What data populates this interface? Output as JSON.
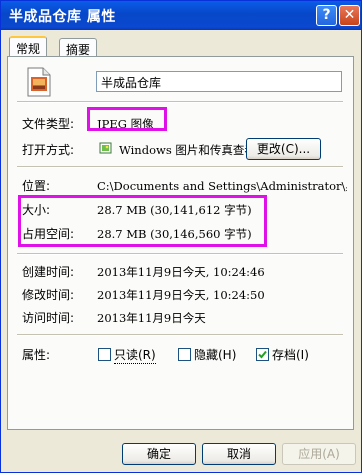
{
  "window": {
    "title": "半成品仓库 属性",
    "help_glyph": "?",
    "close_glyph": "✕"
  },
  "tabs": [
    {
      "label": "常规",
      "active": true
    },
    {
      "label": "摘要",
      "active": false
    }
  ],
  "file": {
    "name": "半成品仓库",
    "icon": "jpeg-image-file-icon"
  },
  "props": {
    "type_label": "文件类型:",
    "type_value": "JPEG 图像",
    "open_label": "打开方式:",
    "open_value": "Windows 图片和传真查看器",
    "open_icon": "windows-picture-viewer-icon",
    "change_button": "更改(C)...",
    "location_label": "位置:",
    "location_value": "C:\\Documents and Settings\\Administrator\\桌面",
    "size_label": "大小:",
    "size_value": "28.7 MB (30,141,612 字节)",
    "disk_label": "占用空间:",
    "disk_value": "28.7 MB (30,146,560 字节)",
    "created_label": "创建时间:",
    "created_value": "2013年11月9日今天, 10:24:46",
    "modified_label": "修改时间:",
    "modified_value": "2013年11月9日今天, 10:24:50",
    "accessed_label": "访问时间:",
    "accessed_value": "2013年11月9日今天",
    "attr_label": "属性:"
  },
  "attributes": [
    {
      "label": "只读(R)",
      "checked": false
    },
    {
      "label": "隐藏(H)",
      "checked": false
    },
    {
      "label": "存档(I)",
      "checked": true
    }
  ],
  "buttons": {
    "ok": "确定",
    "cancel": "取消",
    "apply": "应用(A)"
  },
  "colors": {
    "highlight": "#e010e8",
    "titlebar": "#0a5ce8",
    "tab_accent": "#ffc83c"
  }
}
